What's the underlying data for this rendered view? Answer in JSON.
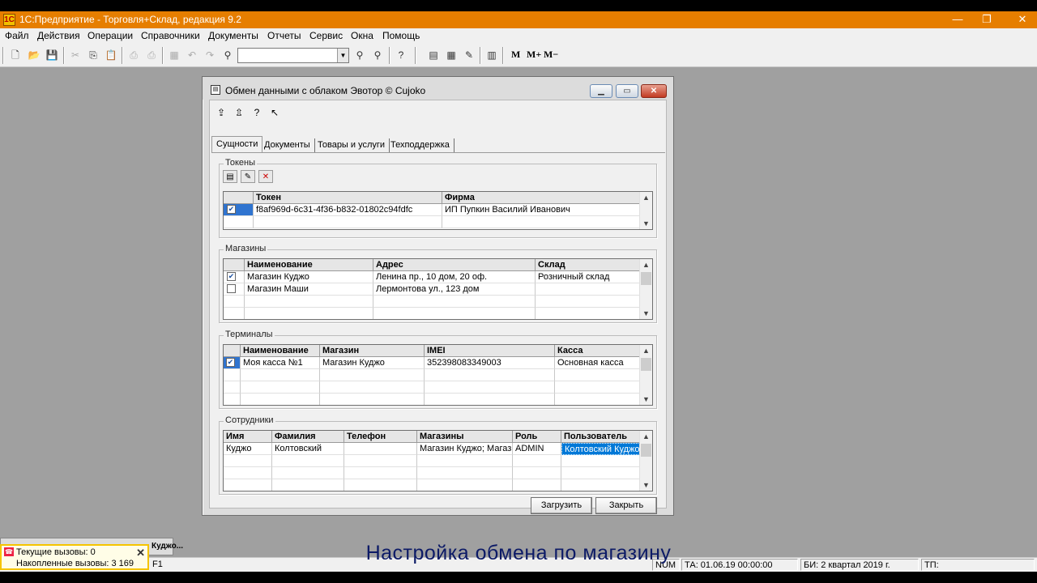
{
  "app": {
    "title": "1С:Предприятие - Торговля+Склад, редакция 9.2",
    "app_icon": "1C",
    "window_buttons": [
      "—",
      "❐",
      "✕"
    ]
  },
  "menu": [
    "Файл",
    "Действия",
    "Операции",
    "Справочники",
    "Документы",
    "Отчеты",
    "Сервис",
    "Окна",
    "Помощь"
  ],
  "toolbar": {
    "search_value": "",
    "text_buttons": [
      "M",
      "M+",
      "M−"
    ]
  },
  "dialog": {
    "title": "Обмен данными с облаком Эвотор © Cujoko",
    "tabs": [
      "Сущности",
      "Документы",
      "Товары и услуги",
      "Техподдержка"
    ],
    "groups": {
      "tokens": {
        "label": "Токены",
        "columns": [
          "Токен",
          "Фирма"
        ],
        "rows": [
          {
            "checked": true,
            "token": "f8af969d-6c31-4f36-b832-01802c94fdfc",
            "firm": "ИП Пупкин Василий Иванович"
          }
        ]
      },
      "stores": {
        "label": "Магазины",
        "columns": [
          "Наименование",
          "Адрес",
          "Склад"
        ],
        "rows": [
          {
            "checked": true,
            "name": "Магазин Куджо",
            "address": "Ленина пр., 10 дом, 20 оф.",
            "warehouse": "Розничный склад"
          },
          {
            "checked": false,
            "name": "Магазин Маши",
            "address": "Лермонтова ул., 123 дом",
            "warehouse": ""
          }
        ]
      },
      "terminals": {
        "label": "Терминалы",
        "columns": [
          "Наименование",
          "Магазин",
          "IMEI",
          "Касса"
        ],
        "rows": [
          {
            "checked": true,
            "name": "Моя касса №1",
            "store": "Магазин Куджо",
            "imei": "352398083349003",
            "cashbox": "Основная касса"
          }
        ]
      },
      "employees": {
        "label": "Сотрудники",
        "columns": [
          "Имя",
          "Фамилия",
          "Телефон",
          "Магазины",
          "Роль",
          "Пользователь"
        ],
        "rows": [
          {
            "first": "Куджо",
            "last": "Колтовский",
            "phone": "",
            "stores": "Магазин Куджо; Магазин Маши",
            "role": "ADMIN",
            "user": "Колтовский Куджо"
          }
        ]
      }
    },
    "buttons": {
      "load": "Загрузить",
      "close": "Закрыть"
    }
  },
  "taskbar": {
    "item": "Куджо..."
  },
  "notification": {
    "current_calls": "Текущие вызовы: 0",
    "accumulated_calls": "Накопленные вызовы: 3 169"
  },
  "statusbar": {
    "hint": "F1",
    "num": "NUM",
    "ta": "ТА: 01.06.19  00:00:00",
    "bi": "БИ: 2 квартал 2019 г.",
    "tp": "ТП:"
  },
  "caption": "Настройка обмена по магазину"
}
